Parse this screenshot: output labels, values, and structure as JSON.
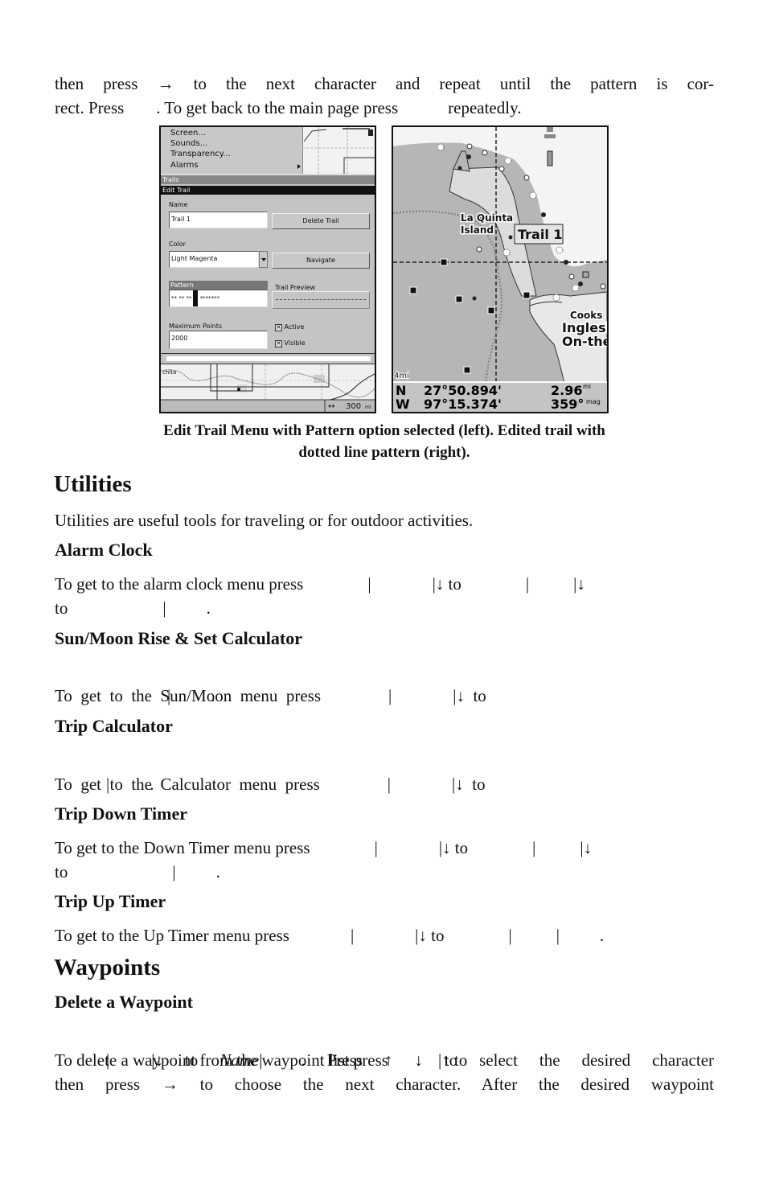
{
  "intro": {
    "line1": "then press → to the next character and repeat until the pattern is cor-",
    "line2_a": "rect. Press",
    "line2_b": ". To get back to the main page press",
    "line2_c": "repeatedly."
  },
  "figure": {
    "left_screen": {
      "menu_items": [
        "Screen...",
        "Sounds...",
        "Transparency...",
        "Alarms"
      ],
      "trails_header": "Trails",
      "edit_trail_header": "Edit Trail",
      "name_label": "Name",
      "name_value": "Trail 1",
      "delete_trail_button": "Delete Trail",
      "color_label": "Color",
      "color_value": "Light Magenta",
      "navigate_button": "Navigate",
      "pattern_label": "Pattern",
      "pattern_value": "**  **  **",
      "pattern_rest": "*******",
      "trail_preview_label": "Trail Preview",
      "max_points_label": "Maximum Points",
      "max_points_value": "2000",
      "active_checkbox": "Active",
      "active_checked": true,
      "visible_checkbox": "Visible",
      "visible_checked": true,
      "map_label": "chita",
      "scale_value": "300",
      "scale_unit": "mi"
    },
    "right_screen": {
      "place_label_1": "La Quinta",
      "place_label_2": "Island",
      "trail_label": "Trail 1",
      "cooks_label": "Cooks",
      "ingleside_label": "Inglesi",
      "onthe_label": "On-the",
      "zoom_scale": "4mi",
      "lat_hemi": "N",
      "lat_value": "27°50.894'",
      "lon_hemi": "W",
      "lon_value": "97°15.374'",
      "distance_value": "2.96",
      "distance_unit": "mi",
      "bearing_value": "359°",
      "bearing_unit": "mag"
    },
    "caption_line1": "Edit Trail Menu with Pattern option selected (left). Edited trail with",
    "caption_line2": "dotted line pattern (right)."
  },
  "utilities": {
    "heading": "Utilities",
    "intro": "Utilities are useful tools for traveling or for outdoor activities.",
    "alarm_clock": {
      "heading": "Alarm Clock",
      "line1": "To get to the alarm clock menu press",
      "line1_to": "↓ to",
      "line1_end": "↓",
      "line2": "to",
      "line2_end": "."
    },
    "sun_moon": {
      "heading": "Sun/Moon Rise & Set Calculator",
      "line1": "To  get  to  the  Sun/Moon  menu  press",
      "line1_to": "↓  to",
      "line2_end": "."
    },
    "trip_calculator": {
      "heading": "Trip Calculator",
      "line1": "To  get  to  the  Calculator  menu  press",
      "line1_to": "↓  to",
      "line2_end": "."
    },
    "trip_down_timer": {
      "heading": "Trip Down Timer",
      "line1": "To get to the Down Timer menu press",
      "line1_to": "↓ to",
      "line1_end": "↓",
      "line2": "to",
      "line2_end": "."
    },
    "trip_up_timer": {
      "heading": "Trip Up Timer",
      "line1": "To get to the Up Timer menu press",
      "line1_to": "↓ to",
      "line1_end": "."
    }
  },
  "waypoints": {
    "heading": "Waypoints",
    "delete": {
      "heading": "Delete a Waypoint",
      "line1": "To delete a waypoint from the waypoint list press",
      "line1_to": "↑ to",
      "line2_a": "↓ to",
      "line2_name": "Name",
      "line2_b": ". Press ↑ ↓ to select the desired character",
      "line3": "then press → to  choose the next character. After the desired waypoint"
    }
  },
  "colors": {
    "screen_gray": "#b9b9b9",
    "highlight_black": "#111111",
    "land_light": "#e6e6e6"
  }
}
